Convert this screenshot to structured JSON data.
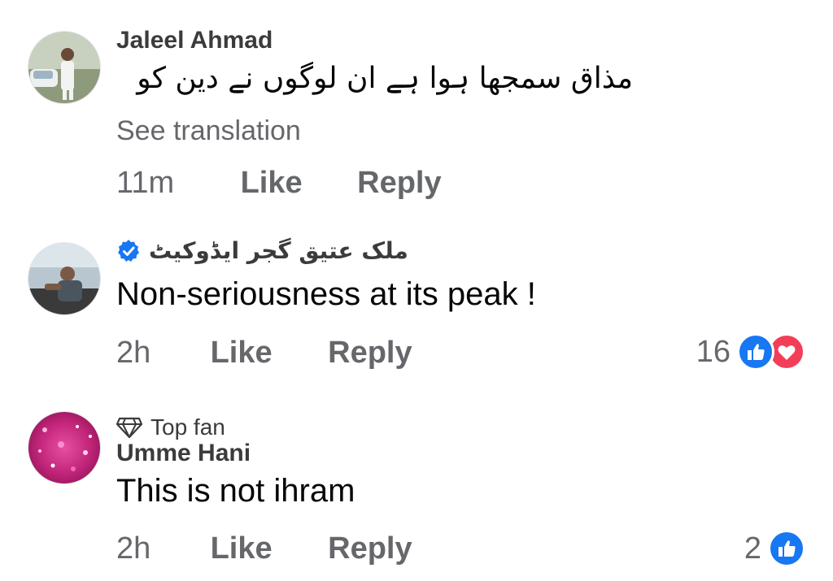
{
  "comments": [
    {
      "author": "Jaleel Ahmad",
      "text": "مذاق سمجھا ہوا ہے ان لوگوں نے دین کو",
      "see_translation": "See translation",
      "time": "11m",
      "like_label": "Like",
      "reply_label": "Reply"
    },
    {
      "author": "ملک عتیق گجر ایڈوکیٹ",
      "verified": true,
      "text": "Non-seriousness at its peak !",
      "time": "2h",
      "like_label": "Like",
      "reply_label": "Reply",
      "reaction_count": "16",
      "reaction_icons": [
        "like-icon",
        "love-icon"
      ]
    },
    {
      "badge": "Top fan",
      "badge_icon": "diamond-icon",
      "author": "Umme Hani",
      "text": "This is not ihram",
      "time": "2h",
      "like_label": "Like",
      "reply_label": "Reply",
      "reaction_count": "2",
      "reaction_icons": [
        "like-icon"
      ]
    }
  ],
  "colors": {
    "like_blue": "#1877f2",
    "love_red": "#f33e58",
    "secondary_text": "#65676b",
    "verified_blue": "#1877f2"
  }
}
